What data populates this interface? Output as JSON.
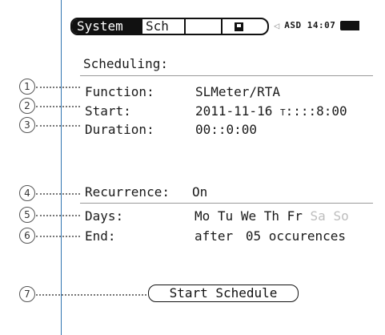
{
  "tabs": {
    "system": "System",
    "sch": "Sch",
    "blank": ""
  },
  "icons": {
    "save": "floppy-disk-icon",
    "speaker": "speaker-icon",
    "battery": "battery-icon"
  },
  "status": {
    "text": "ASD 14:07"
  },
  "scheduling": {
    "title": "Scheduling:",
    "function_label": "Function:",
    "function_value": "SLMeter/RTA",
    "start_label": "Start:",
    "start_value": "2011-11-16 ",
    "start_time_marker": "T",
    "start_time": "::::8:00",
    "duration_label": "Duration:",
    "duration_value": "00::0:00",
    "recurrence_label": "Recurrence:",
    "recurrence_value": "On",
    "days_label": "Days:",
    "days": [
      "Mo",
      "Tu",
      "We",
      "Th",
      "Fr",
      "Sa",
      "So"
    ],
    "end_label": "End:",
    "end_after": "after",
    "end_count": "05",
    "end_unit": "occurences"
  },
  "button": {
    "start_schedule": "Start Schedule"
  },
  "callouts": [
    "1",
    "2",
    "3",
    "4",
    "5",
    "6",
    "7"
  ],
  "colors": {
    "screen_border": "#2f74b0",
    "disabled_day": "#bdbdbd"
  }
}
